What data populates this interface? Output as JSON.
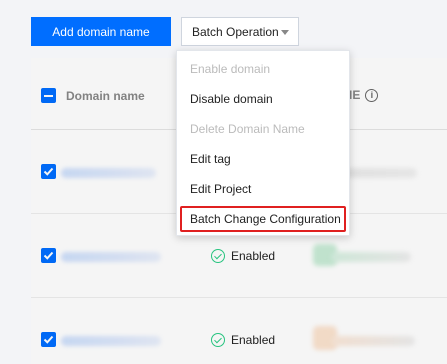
{
  "toolbar": {
    "add_label": "Add domain name",
    "batch_label": "Batch Operation"
  },
  "table": {
    "col_domain": "Domain name",
    "col_status_suffix": "IE",
    "rows": [
      {
        "status": ""
      },
      {
        "status": "Enabled"
      },
      {
        "status": "Enabled"
      }
    ]
  },
  "menu": {
    "items": [
      {
        "label": "Enable domain",
        "disabled": true
      },
      {
        "label": "Disable domain",
        "disabled": false
      },
      {
        "label": "Delete Domain Name",
        "disabled": true
      },
      {
        "label": "Edit tag",
        "disabled": false
      },
      {
        "label": "Edit Project",
        "disabled": false
      },
      {
        "label": "Batch Change Configuration",
        "disabled": false,
        "highlighted": true
      }
    ]
  },
  "colors": {
    "primary": "#006eff",
    "success": "#29cc85",
    "highlight_border": "#e02020"
  }
}
